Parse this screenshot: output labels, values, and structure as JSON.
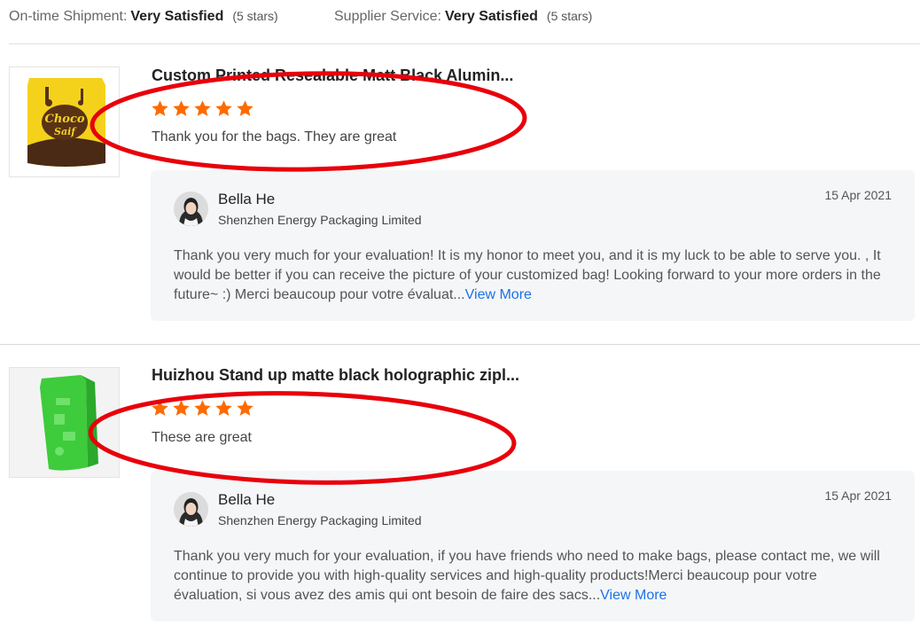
{
  "summary": [
    {
      "label": "On-time Shipment:",
      "value": "Very Satisfied",
      "stars": "(5 stars)"
    },
    {
      "label": "Supplier Service:",
      "value": "Very Satisfied",
      "stars": "(5 stars)"
    }
  ],
  "colors": {
    "star": "#ff6a00",
    "link": "#1a73e8",
    "annotation": "#e8000b",
    "reply_bg": "#f5f6f8"
  },
  "reviews": [
    {
      "product_title": "Custom Printed Resealable Matt Black Alumin...",
      "rating": 5,
      "comment": "Thank you for the bags. They are great",
      "thumbnail_icon": "yellow-choco-pouch-image",
      "reply": {
        "name": "Bella He",
        "company": "Shenzhen Energy Packaging Limited",
        "date": "15 Apr 2021",
        "text": "Thank you very much for your evaluation! It is my honor to meet you, and it is my luck to be able to serve you. , It would be better if you can receive the picture of your customized bag! Looking forward to your more orders in the future~    :)   Merci beaucoup pour votre évaluat...",
        "view_more": "View More"
      }
    },
    {
      "product_title": "Huizhou Stand up matte black holographic zipl...",
      "rating": 5,
      "comment": "These are great",
      "thumbnail_icon": "green-stand-up-pouch-image",
      "reply": {
        "name": "Bella He",
        "company": "Shenzhen Energy Packaging Limited",
        "date": "15 Apr 2021",
        "text": "Thank you very much for your evaluation, if you have friends who need to make bags, please contact me, we will continue to provide you with high-quality services and high-quality products!Merci beaucoup pour votre évaluation, si vous avez des amis qui ont besoin de faire des sacs...",
        "view_more": "View More"
      }
    }
  ]
}
